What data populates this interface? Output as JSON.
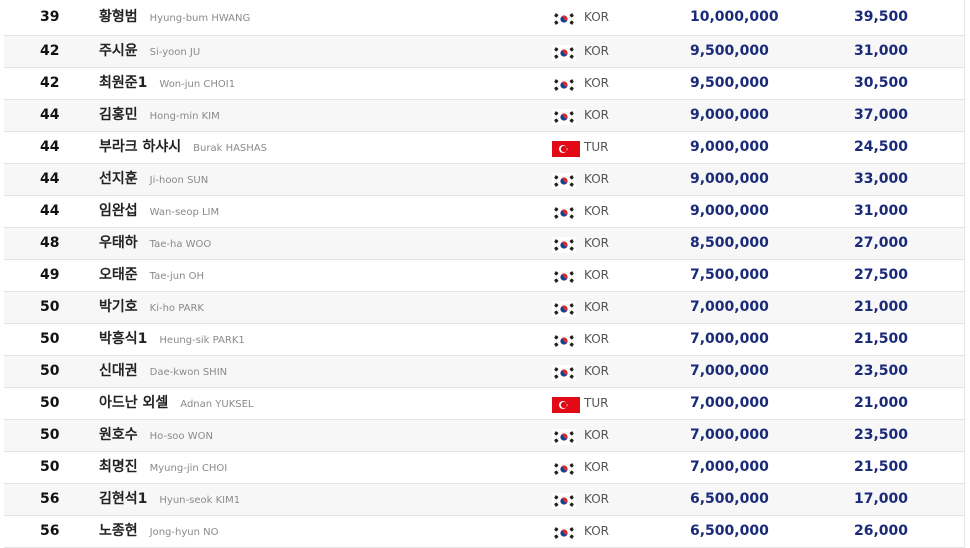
{
  "colors": {
    "prize_text": "#1a2a7a",
    "row_alt": "#f7f7f7",
    "border": "#e4e4e4",
    "tur_flag": "#e30a17"
  },
  "rows": [
    {
      "rank": "39",
      "name_ko": "황형범",
      "name_en": "Hyung-bum HWANG",
      "flag": "kor-flag-icon",
      "nation": "KOR",
      "prize": "10,000,000",
      "points": "39,500"
    },
    {
      "rank": "42",
      "name_ko": "주시윤",
      "name_en": "Si-yoon JU",
      "flag": "kor-flag-icon",
      "nation": "KOR",
      "prize": "9,500,000",
      "points": "31,000"
    },
    {
      "rank": "42",
      "name_ko": "최원준1",
      "name_en": "Won-jun CHOI1",
      "flag": "kor-flag-icon",
      "nation": "KOR",
      "prize": "9,500,000",
      "points": "30,500"
    },
    {
      "rank": "44",
      "name_ko": "김홍민",
      "name_en": "Hong-min KIM",
      "flag": "kor-flag-icon",
      "nation": "KOR",
      "prize": "9,000,000",
      "points": "37,000"
    },
    {
      "rank": "44",
      "name_ko": "부라크 하샤시",
      "name_en": "Burak HASHAS",
      "flag": "tur-flag-icon",
      "nation": "TUR",
      "prize": "9,000,000",
      "points": "24,500"
    },
    {
      "rank": "44",
      "name_ko": "선지훈",
      "name_en": "Ji-hoon SUN",
      "flag": "kor-flag-icon",
      "nation": "KOR",
      "prize": "9,000,000",
      "points": "33,000"
    },
    {
      "rank": "44",
      "name_ko": "임완섭",
      "name_en": "Wan-seop LIM",
      "flag": "kor-flag-icon",
      "nation": "KOR",
      "prize": "9,000,000",
      "points": "31,000"
    },
    {
      "rank": "48",
      "name_ko": "우태하",
      "name_en": "Tae-ha WOO",
      "flag": "kor-flag-icon",
      "nation": "KOR",
      "prize": "8,500,000",
      "points": "27,000"
    },
    {
      "rank": "49",
      "name_ko": "오태준",
      "name_en": "Tae-jun OH",
      "flag": "kor-flag-icon",
      "nation": "KOR",
      "prize": "7,500,000",
      "points": "27,500"
    },
    {
      "rank": "50",
      "name_ko": "박기호",
      "name_en": "Ki-ho PARK",
      "flag": "kor-flag-icon",
      "nation": "KOR",
      "prize": "7,000,000",
      "points": "21,000"
    },
    {
      "rank": "50",
      "name_ko": "박흥식1",
      "name_en": "Heung-sik PARK1",
      "flag": "kor-flag-icon",
      "nation": "KOR",
      "prize": "7,000,000",
      "points": "21,500"
    },
    {
      "rank": "50",
      "name_ko": "신대권",
      "name_en": "Dae-kwon SHIN",
      "flag": "kor-flag-icon",
      "nation": "KOR",
      "prize": "7,000,000",
      "points": "23,500"
    },
    {
      "rank": "50",
      "name_ko": "아드난 외셀",
      "name_en": "Adnan YUKSEL",
      "flag": "tur-flag-icon",
      "nation": "TUR",
      "prize": "7,000,000",
      "points": "21,000"
    },
    {
      "rank": "50",
      "name_ko": "원호수",
      "name_en": "Ho-soo WON",
      "flag": "kor-flag-icon",
      "nation": "KOR",
      "prize": "7,000,000",
      "points": "23,500"
    },
    {
      "rank": "50",
      "name_ko": "최명진",
      "name_en": "Myung-jin CHOI",
      "flag": "kor-flag-icon",
      "nation": "KOR",
      "prize": "7,000,000",
      "points": "21,500"
    },
    {
      "rank": "56",
      "name_ko": "김현석1",
      "name_en": "Hyun-seok KIM1",
      "flag": "kor-flag-icon",
      "nation": "KOR",
      "prize": "6,500,000",
      "points": "17,000"
    },
    {
      "rank": "56",
      "name_ko": "노종현",
      "name_en": "Jong-hyun NO",
      "flag": "kor-flag-icon",
      "nation": "KOR",
      "prize": "6,500,000",
      "points": "26,000"
    }
  ]
}
